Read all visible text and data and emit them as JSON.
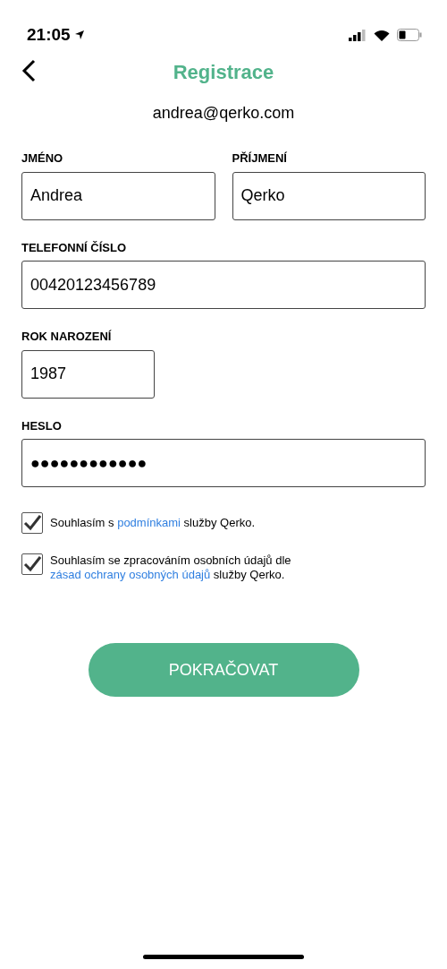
{
  "status_bar": {
    "time": "21:05"
  },
  "header": {
    "title": "Registrace"
  },
  "email": "andrea@qerko.com",
  "fields": [
    {
      "label": "JMÉNO",
      "value": "Andrea"
    },
    {
      "label": "PŘÍJMENÍ",
      "value": "Qerko"
    },
    {
      "label": "TELEFONNÍ ČÍSLO",
      "value": "00420123456789"
    },
    {
      "label": "ROK NAROZENÍ",
      "value": "1987"
    },
    {
      "label": "HESLO",
      "value": "●●●●●●●●●●●●"
    }
  ],
  "consents": [
    {
      "checked": true,
      "before": "Souhlasím s ",
      "link": "podmínkami",
      "after": " služby Qerko."
    },
    {
      "checked": true,
      "before": "Souhlasím se zpracováním osobních údajů dle ",
      "link": "zásad ochrany osobných údajů",
      "after": " služby Qerko."
    }
  ],
  "button": {
    "label": "POKRAČOVAT"
  }
}
